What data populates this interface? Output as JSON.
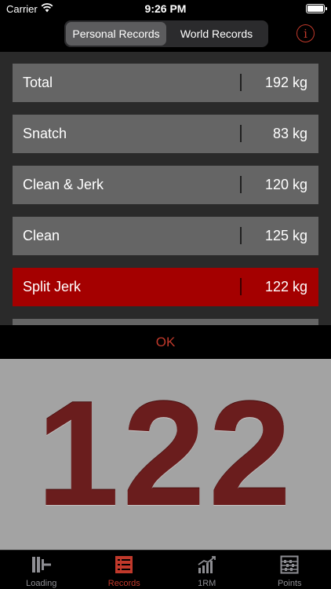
{
  "status": {
    "carrier": "Carrier",
    "time": "9:26 PM"
  },
  "header": {
    "segments": [
      {
        "label": "Personal Records",
        "active": true
      },
      {
        "label": "World Records",
        "active": false
      }
    ],
    "info_icon": "info-icon",
    "info_glyph": "i"
  },
  "records": [
    {
      "label": "Total",
      "value": "192 kg",
      "selected": false
    },
    {
      "label": "Snatch",
      "value": "83 kg",
      "selected": false
    },
    {
      "label": "Clean & Jerk",
      "value": "120 kg",
      "selected": false
    },
    {
      "label": "Clean",
      "value": "125 kg",
      "selected": false
    },
    {
      "label": "Split Jerk",
      "value": "122 kg",
      "selected": true
    }
  ],
  "ok_label": "OK",
  "display": {
    "number": "122"
  },
  "tabs": [
    {
      "label": "Loading",
      "icon": "barbell-icon",
      "active": false
    },
    {
      "label": "Records",
      "icon": "list-icon",
      "active": true
    },
    {
      "label": "1RM",
      "icon": "bar-chart-icon",
      "active": false
    },
    {
      "label": "Points",
      "icon": "abacus-icon",
      "active": false
    }
  ],
  "colors": {
    "accent": "#c0392b",
    "row_bg": "#656565",
    "row_selected_bg": "#a40000",
    "display_bg": "#a3a3a3",
    "number_color": "#6a1d1d"
  }
}
